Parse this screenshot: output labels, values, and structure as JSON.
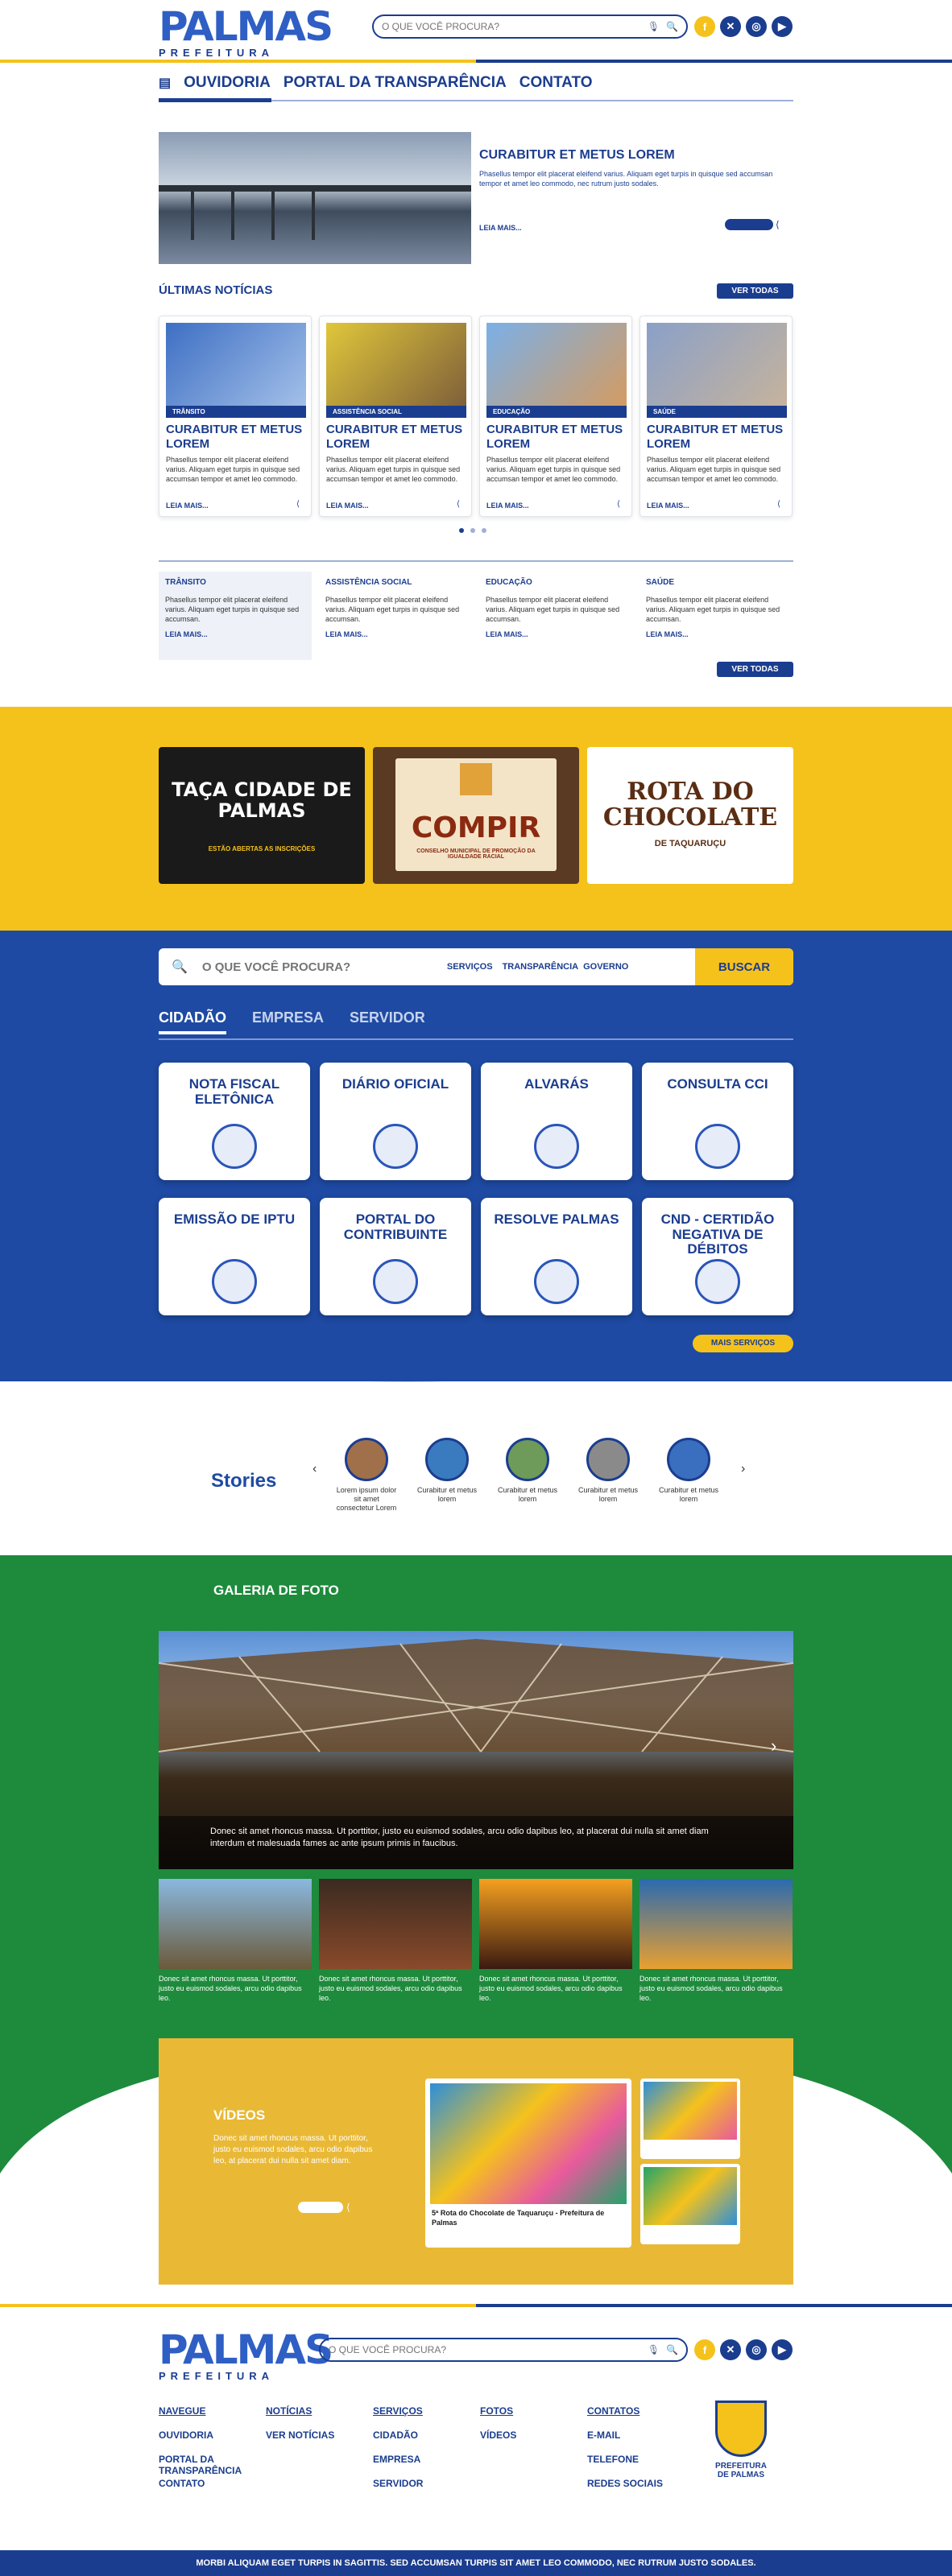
{
  "header": {
    "logo_main": "PALMAS",
    "logo_sub": "PREFEITURA",
    "search_placeholder": "O QUE VOCÊ PROCURA?",
    "social": [
      "f",
      "✕",
      "◎",
      "▶"
    ]
  },
  "topnav": [
    "OUVIDORIA",
    "PORTAL DA TRANSPARÊNCIA",
    "CONTATO"
  ],
  "featured": {
    "title": "CURABITUR ET METUS LOREM",
    "text": "Phasellus tempor elit placerat eleifend varius. Aliquam eget turpis in quisque sed accumsan tempor et amet leo commodo, nec rutrum justo sodales.",
    "more": "LEIA MAIS..."
  },
  "news": {
    "heading": "ÚLTIMAS NOTÍCIAS",
    "see_all": "VER TODAS",
    "cards": [
      {
        "tag": "TRÂNSITO",
        "title": "CURABITUR ET METUS LOREM",
        "text": "Phasellus tempor elit placerat eleifend varius. Aliquam eget turpis in quisque sed accumsan tempor et amet leo commodo.",
        "more": "LEIA MAIS..."
      },
      {
        "tag": "ASSISTÊNCIA SOCIAL",
        "title": "CURABITUR ET METUS LOREM",
        "text": "Phasellus tempor elit placerat eleifend varius. Aliquam eget turpis in quisque sed accumsan tempor et amet leo commodo.",
        "more": "LEIA MAIS..."
      },
      {
        "tag": "EDUCAÇÃO",
        "title": "CURABITUR ET METUS LOREM",
        "text": "Phasellus tempor elit placerat eleifend varius. Aliquam eget turpis in quisque sed accumsan tempor et amet leo commodo.",
        "more": "LEIA MAIS..."
      },
      {
        "tag": "SAÚDE",
        "title": "CURABITUR ET METUS LOREM",
        "text": "Phasellus tempor elit placerat eleifend varius. Aliquam eget turpis in quisque sed accumsan tempor et amet leo commodo.",
        "more": "LEIA MAIS..."
      }
    ],
    "list": [
      {
        "tag": "TRÂNSITO",
        "text": "Phasellus tempor elit placerat eleifend varius. Aliquam eget turpis in quisque sed accumsan.",
        "more": "LEIA MAIS..."
      },
      {
        "tag": "ASSISTÊNCIA SOCIAL",
        "text": "Phasellus tempor elit placerat eleifend varius. Aliquam eget turpis in quisque sed accumsan.",
        "more": "LEIA MAIS..."
      },
      {
        "tag": "EDUCAÇÃO",
        "text": "Phasellus tempor elit placerat eleifend varius. Aliquam eget turpis in quisque sed accumsan.",
        "more": "LEIA MAIS..."
      },
      {
        "tag": "SAÚDE",
        "text": "Phasellus tempor elit placerat eleifend varius. Aliquam eget turpis in quisque sed accumsan.",
        "more": "LEIA MAIS..."
      }
    ],
    "see_all_2": "VER TODAS"
  },
  "banners": [
    {
      "title": "TAÇA CIDADE DE PALMAS",
      "sub": "ESTÃO ABERTAS AS INSCRIÇÕES"
    },
    {
      "title": "COMPIR",
      "sub": "CONSELHO MUNICIPAL DE PROMOÇÃO DA IGUALDADE RACIAL"
    },
    {
      "title": "ROTA DO CHOCOLATE",
      "sub": "DE TAQUARUÇU"
    }
  ],
  "services": {
    "search_placeholder": "O QUE VOCÊ PROCURA?",
    "links": [
      "SERVIÇOS",
      "TRANSPARÊNCIA",
      "GOVERNO"
    ],
    "search_button": "BUSCAR",
    "tabs": [
      "CIDADÃO",
      "EMPRESA",
      "SERVIDOR"
    ],
    "items": [
      "NOTA FISCAL ELETÔNICA",
      "DIÁRIO OFICIAL",
      "ALVARÁS",
      "CONSULTA CCI",
      "EMISSÃO DE IPTU",
      "PORTAL DO CONTRIBUINTE",
      "RESOLVE PALMAS",
      "CND - CERTIDÃO NEGATIVA DE DÉBITOS"
    ],
    "more": "MAIS SERVIÇOS"
  },
  "stories": {
    "title": "Stories",
    "items": [
      "Lorem ipsum dolor sit amet consectetur Lorem",
      "Curabitur et metus lorem",
      "Curabitur et metus lorem",
      "Curabitur et metus lorem",
      "Curabitur et metus lorem"
    ]
  },
  "gallery": {
    "title": "GALERIA DE FOTO",
    "caption": "Donec sit amet rhoncus massa. Ut porttitor, justo eu euismod sodales, arcu odio dapibus leo, at placerat dui nulla sit amet diam interdum et malesuada fames ac ante ipsum primis in faucibus.",
    "thumbs": [
      "Donec sit amet rhoncus massa. Ut porttitor, justo eu euismod sodales, arcu odio dapibus leo.",
      "Donec sit amet rhoncus massa. Ut porttitor, justo eu euismod sodales, arcu odio dapibus leo.",
      "Donec sit amet rhoncus massa. Ut porttitor, justo eu euismod sodales, arcu odio dapibus leo.",
      "Donec sit amet rhoncus massa. Ut porttitor, justo eu euismod sodales, arcu odio dapibus leo."
    ]
  },
  "videos": {
    "title": "VÍDEOS",
    "text": "Donec sit amet rhoncus massa. Ut porttitor, justo eu euismod sodales, arcu odio dapibus leo, at placerat dui nulla sit amet diam.",
    "main_caption": "5ª Rota do Chocolate de Taquaruçu - Prefeitura de Palmas"
  },
  "footer": {
    "logo_main": "PALMAS",
    "logo_sub": "PREFEITURA",
    "search_placeholder": "O QUE VOCÊ PROCURA?",
    "cols": [
      [
        "NAVEGUE",
        "OUVIDORIA",
        "PORTAL DA TRANSPARÊNCIA",
        "CONTATO"
      ],
      [
        "NOTÍCIAS",
        "VER NOTÍCIAS"
      ],
      [
        "SERVIÇOS",
        "CIDADÃO",
        "EMPRESA",
        "SERVIDOR"
      ],
      [
        "FOTOS",
        "VÍDEOS"
      ],
      [
        "CONTATOS",
        "E-MAIL",
        "TELEFONE",
        "REDES SOCIAIS"
      ]
    ],
    "seal_text": "PREFEITURA DE PALMAS",
    "bottom": "MORBI ALIQUAM EGET TURPIS IN SAGITTIS. SED ACCUMSAN TURPIS SIT AMET LEO COMMODO, NEC RUTRUM JUSTO SODALES."
  },
  "colors": {
    "blue": "#1b3d8f",
    "yellow": "#f5c21c",
    "green": "#1e8a3c"
  }
}
